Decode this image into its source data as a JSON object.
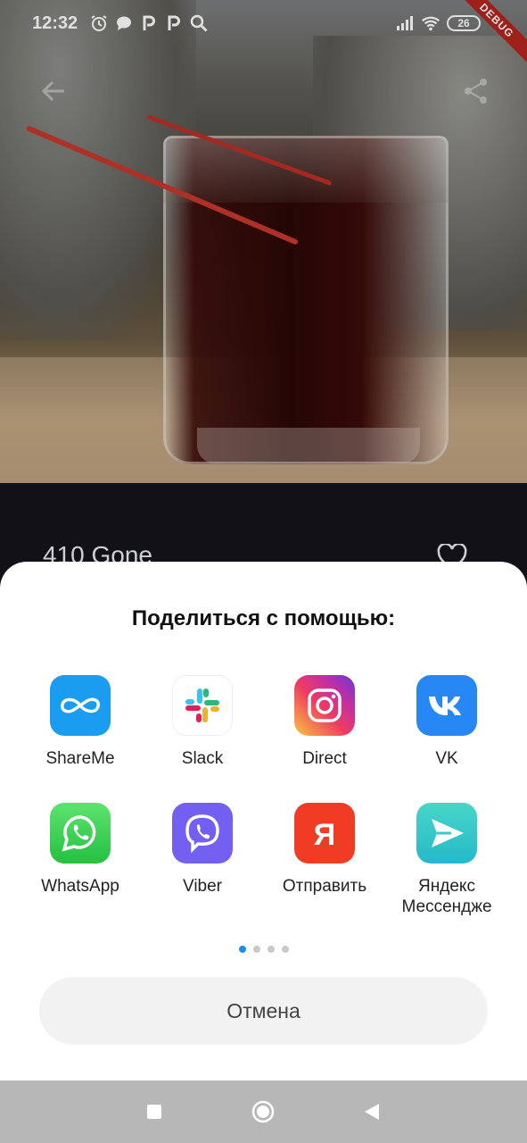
{
  "status_bar": {
    "time": "12:32",
    "battery": "26",
    "debug_label": "DEBUG"
  },
  "content": {
    "item_title": "410 Gone"
  },
  "share_sheet": {
    "title": "Поделиться с помощью:",
    "apps": [
      {
        "label": "ShareMe",
        "icon": "shareme-icon",
        "color": "#1a9cf0"
      },
      {
        "label": "Slack",
        "icon": "slack-icon",
        "color": "#ffffff"
      },
      {
        "label": "Direct",
        "icon": "instagram-icon",
        "color": "#d6287b"
      },
      {
        "label": "VK",
        "icon": "vk-icon",
        "color": "#2787f5"
      },
      {
        "label": "WhatsApp",
        "icon": "whatsapp-icon",
        "color": "#2cc84d"
      },
      {
        "label": "Viber",
        "icon": "viber-icon",
        "color": "#7360f2"
      },
      {
        "label": "Отправить",
        "icon": "yandex-icon",
        "color": "#f03c25"
      },
      {
        "label": "Яндекс Мессендже",
        "icon": "yandex-messenger-icon",
        "color": "#2fc4c7"
      }
    ],
    "page_count": 4,
    "active_page": 0,
    "cancel_label": "Отмена"
  },
  "colors": {
    "accent": "#1f8fe6",
    "sheet_bg": "#ffffff",
    "navbar_bg": "#b7b7b7"
  }
}
